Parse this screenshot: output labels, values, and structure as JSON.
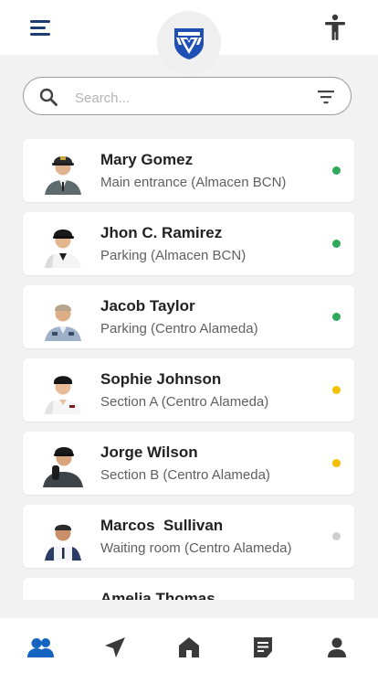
{
  "colors": {
    "accent": "#1565c0",
    "icon": "#3a3a3a",
    "online": "#2eaa5a",
    "away": "#f5c000",
    "offline": "#cfcfcf"
  },
  "header": {
    "menu_icon": "menu-icon",
    "logo_icon": "shield-logo-icon",
    "accessibility_icon": "accessibility-icon"
  },
  "search": {
    "placeholder": "Search...",
    "value": "",
    "search_icon": "search-icon",
    "filter_icon": "filter-icon"
  },
  "guards": [
    {
      "name": "Mary Gomez",
      "location": "Main entrance (Almacen BCN)",
      "status": "online"
    },
    {
      "name": "Jhon C. Ramirez",
      "location": "Parking (Almacen BCN)",
      "status": "online"
    },
    {
      "name": "Jacob Taylor",
      "location": "Parking (Centro Alameda)",
      "status": "online"
    },
    {
      "name": "Sophie Johnson",
      "location": "Section A (Centro Alameda)",
      "status": "away"
    },
    {
      "name": "Jorge Wilson",
      "location": "Section B (Centro Alameda)",
      "status": "away"
    },
    {
      "name": "Marcos  Sullivan",
      "location": "Waiting room (Centro Alameda)",
      "status": "offline"
    },
    {
      "name": "Amelia Thomas",
      "location": "",
      "status": ""
    }
  ],
  "bottom_nav": [
    {
      "icon": "users-icon",
      "active": true
    },
    {
      "icon": "navigation-icon",
      "active": false
    },
    {
      "icon": "home-icon",
      "active": false
    },
    {
      "icon": "document-icon",
      "active": false
    },
    {
      "icon": "profile-icon",
      "active": false
    }
  ]
}
